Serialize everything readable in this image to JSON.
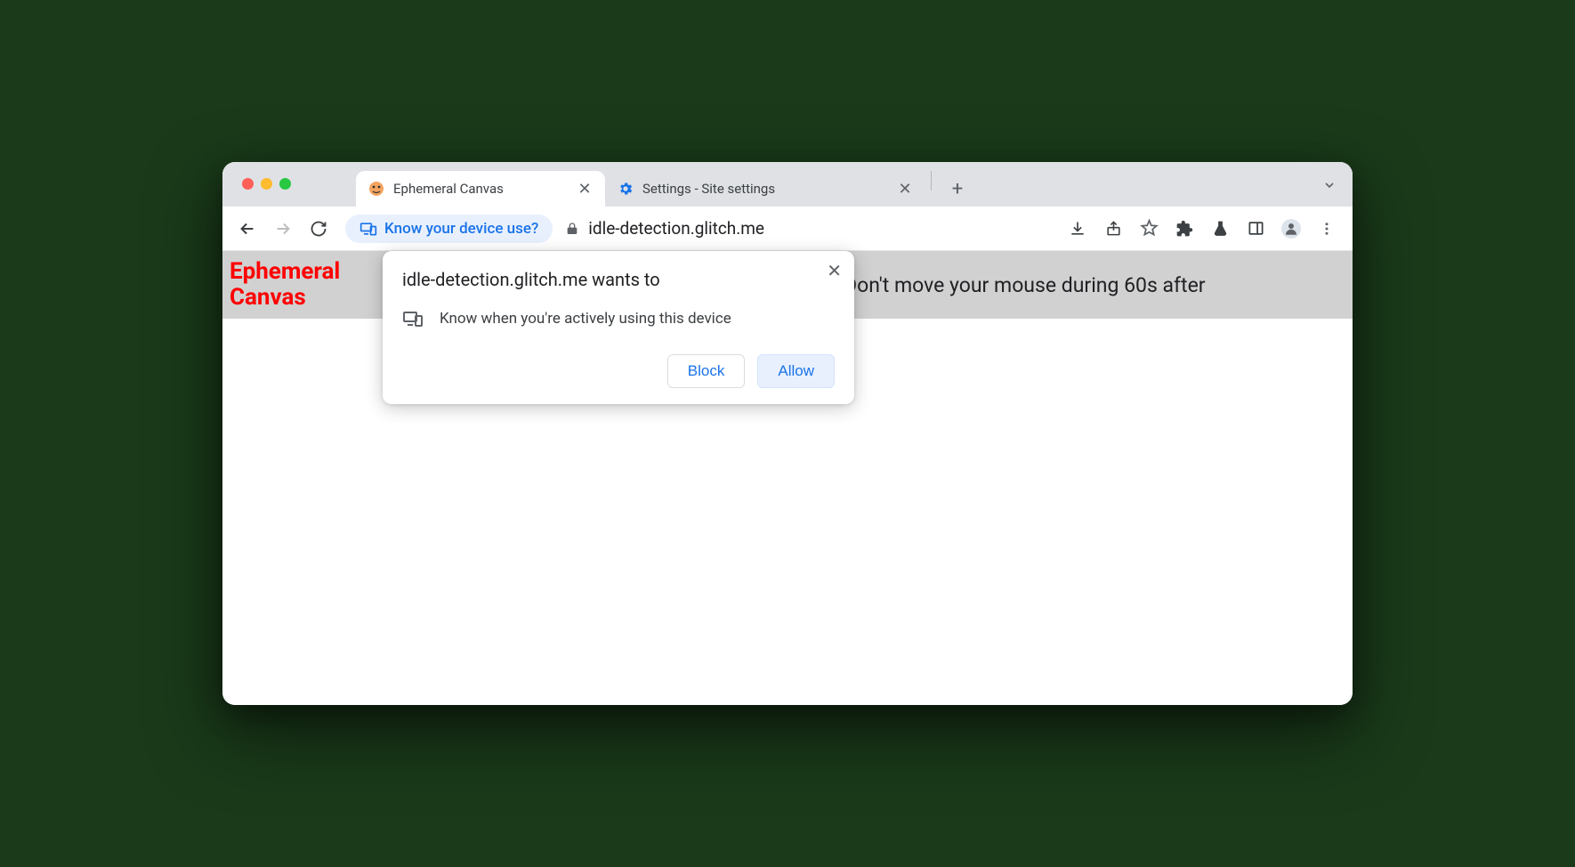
{
  "tabs": [
    {
      "title": "Ephemeral Canvas",
      "active": true
    },
    {
      "title": "Settings - Site settings",
      "active": false
    }
  ],
  "addressbar": {
    "chip_label": "Know your device use?",
    "url": "idle-detection.glitch.me"
  },
  "page": {
    "title": "Ephemeral Canvas",
    "banner_text": "Don't move your mouse during 60s after"
  },
  "permission_prompt": {
    "title": "idle-detection.glitch.me wants to",
    "request_text": "Know when you're actively using this device",
    "block_label": "Block",
    "allow_label": "Allow"
  }
}
